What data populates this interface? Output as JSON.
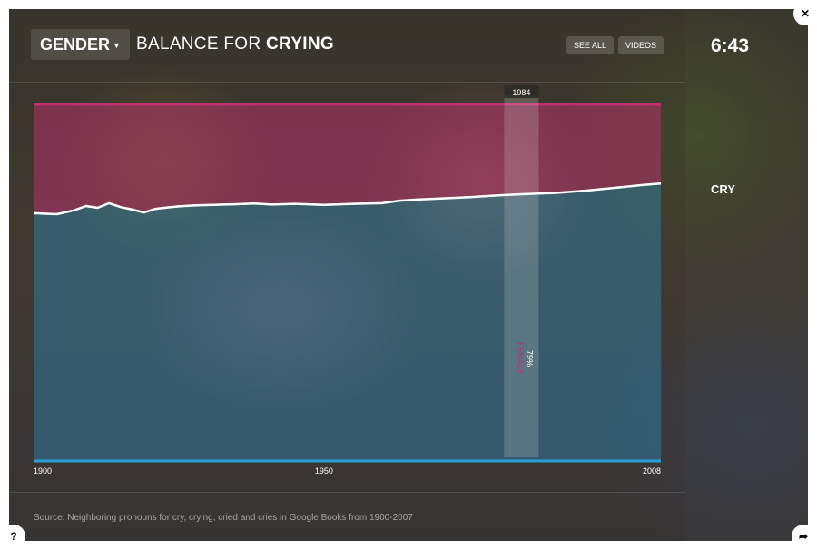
{
  "header": {
    "dimension_label": "GENDER",
    "title_prefix": "BALANCE FOR",
    "title_word": "CRYING",
    "see_all_label": "SEE ALL",
    "videos_label": "VIDEOS"
  },
  "side_panel": {
    "timer": "6:43",
    "word": "CRY"
  },
  "source": "Source: Neighboring pronouns for cry, crying, cried and cries in Google Books from 1900-2007",
  "icons": {
    "close": "close-icon",
    "help": "question-icon",
    "share": "share-arrow-icon",
    "dropdown": "chevron-down-icon"
  },
  "colors": {
    "female": "#c0306e",
    "male": "#2a9fd6",
    "line": "#ffffff",
    "highlight": "#d8d8d8"
  },
  "chart_data": {
    "type": "area",
    "title": "BALANCE FOR CRYING",
    "xlim": [
      1900,
      2008
    ],
    "ylim": [
      0,
      100
    ],
    "x_ticks": [
      "1900",
      "1950",
      "2008"
    ],
    "series": [
      {
        "name": "FEMALE",
        "color": "#c0306e"
      },
      {
        "name": "",
        "color": "#2a9fd6"
      }
    ],
    "x": [
      1900,
      1904,
      1907,
      1909,
      1911,
      1913,
      1915,
      1917,
      1919,
      1921,
      1923,
      1925,
      1928,
      1931,
      1935,
      1938,
      1941,
      1945,
      1950,
      1955,
      1960,
      1963,
      1966,
      1970,
      1975,
      1980,
      1984,
      1990,
      1995,
      2000,
      2005,
      2008
    ],
    "female_share": [
      69.5,
      69.2,
      70.3,
      71.5,
      71.0,
      72.3,
      71.2,
      70.5,
      69.7,
      70.7,
      71.1,
      71.4,
      71.7,
      71.8,
      72.0,
      72.2,
      71.9,
      72.1,
      71.8,
      72.1,
      72.3,
      73.0,
      73.3,
      73.6,
      74.0,
      74.5,
      74.8,
      75.2,
      75.8,
      76.6,
      77.4,
      77.8
    ],
    "highlight": {
      "year": "1984",
      "value_label": "79%",
      "series_label": "FEMALE"
    },
    "grid": false,
    "legend": "none"
  }
}
